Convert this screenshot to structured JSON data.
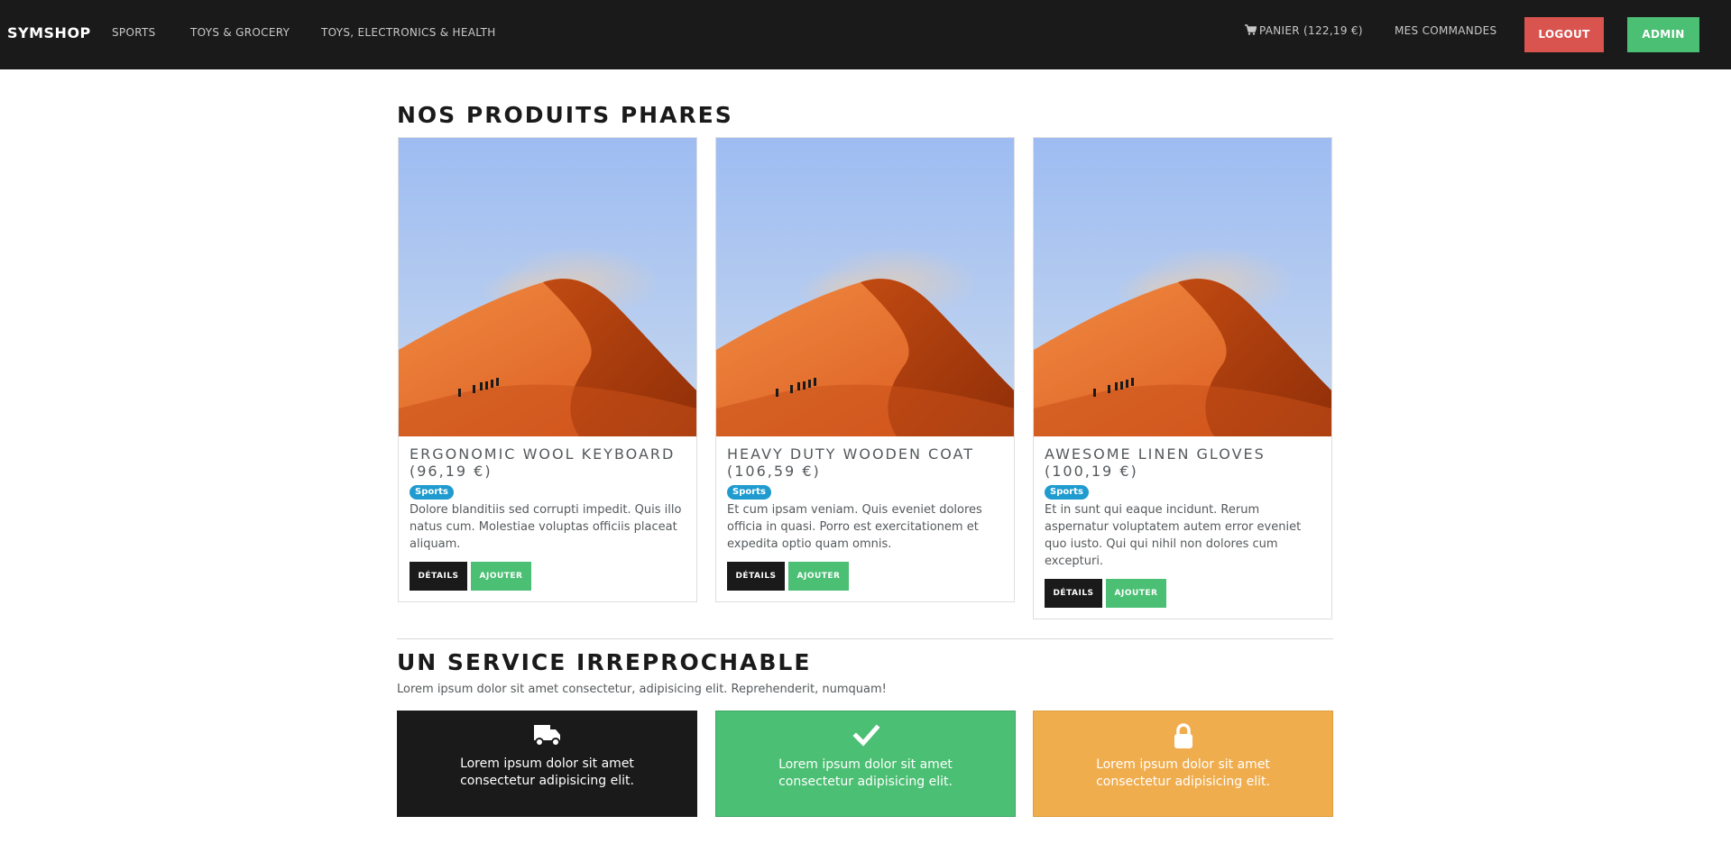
{
  "navbar": {
    "brand": "SYMSHOP",
    "links": [
      "SPORTS",
      "TOYS & GROCERY",
      "TOYS, ELECTRONICS & HEALTH"
    ],
    "cart_label": "PANIER (122,19 €)",
    "orders_label": "MES COMMANDES",
    "logout_label": "LOGOUT",
    "admin_label": "ADMIN",
    "icons": {
      "cart": "cart-icon"
    },
    "colors": {
      "background": "#1a1a1a",
      "logout": "#d9534f",
      "admin": "#4bbf73"
    }
  },
  "featured": {
    "title": "NOS PRODUITS PHARES",
    "products": [
      {
        "title": "ERGONOMIC WOOL KEYBOARD (96,19 €)",
        "category": "Sports",
        "description": "Dolore blanditiis sed corrupti impedit. Quis illo natus cum. Molestiae voluptas officiis placeat aliquam.",
        "details_label": "DÉTAILS",
        "add_label": "AJOUTER"
      },
      {
        "title": "HEAVY DUTY WOODEN COAT (106,59 €)",
        "category": "Sports",
        "description": "Et cum ipsam veniam. Quis eveniet dolores officia in quasi. Porro est exercitationem et expedita optio quam omnis.",
        "details_label": "DÉTAILS",
        "add_label": "AJOUTER"
      },
      {
        "title": "AWESOME LINEN GLOVES (100,19 €)",
        "category": "Sports",
        "description": "Et in sunt qui eaque incidunt. Rerum aspernatur voluptatem autem error eveniet quo iusto. Qui qui nihil non dolores cum excepturi.",
        "details_label": "DÉTAILS",
        "add_label": "AJOUTER"
      }
    ]
  },
  "service": {
    "title": "UN SERVICE IRREPROCHABLE",
    "lead": "Lorem ipsum dolor sit amet consectetur, adipisicing elit. Reprehenderit, numquam!",
    "features": [
      {
        "icon": "truck-icon",
        "text": "Lorem ipsum dolor sit amet consectetur adipisicing elit.",
        "color": "#1a1a1a"
      },
      {
        "icon": "checkmark-icon",
        "text": "Lorem ipsum dolor sit amet consectetur adipisicing elit.",
        "color": "#4bbf73"
      },
      {
        "icon": "lock-icon",
        "text": "Lorem ipsum dolor sit amet consectetur adipisicing elit.",
        "color": "#f0ad4e"
      }
    ]
  },
  "colors": {
    "badge": "#1f9bcf",
    "text": "#55595c",
    "heading": "#1a1a1a"
  }
}
